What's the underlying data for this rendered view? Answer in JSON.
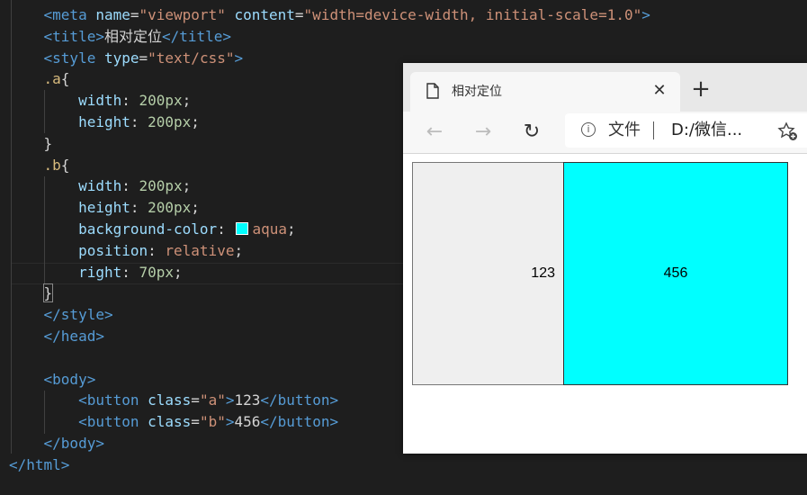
{
  "editor": {
    "lines": [
      {
        "indent": "    ",
        "tokens": [
          [
            "tag",
            "<meta "
          ],
          [
            "attr",
            "name"
          ],
          [
            "txt",
            "="
          ],
          [
            "str",
            "\"viewport\""
          ],
          [
            "txt",
            " "
          ],
          [
            "attr",
            "content"
          ],
          [
            "txt",
            "="
          ],
          [
            "str",
            "\"width=device-width, initial-scale=1.0\""
          ],
          [
            "tag",
            ">"
          ]
        ]
      },
      {
        "indent": "    ",
        "tokens": [
          [
            "tag",
            "<title>"
          ],
          [
            "txt",
            "相对定位"
          ],
          [
            "tag",
            "</title>"
          ]
        ]
      },
      {
        "indent": "    ",
        "tokens": [
          [
            "tag",
            "<style "
          ],
          [
            "attr",
            "type"
          ],
          [
            "txt",
            "="
          ],
          [
            "str",
            "\"text/css\""
          ],
          [
            "tag",
            ">"
          ]
        ]
      },
      {
        "indent": "    ",
        "tokens": [
          [
            "sel",
            ".a"
          ],
          [
            "brace",
            "{"
          ]
        ]
      },
      {
        "indent": "        ",
        "tokens": [
          [
            "prop",
            "width"
          ],
          [
            "txt",
            ": "
          ],
          [
            "num",
            "200px"
          ],
          [
            "txt",
            ";"
          ]
        ]
      },
      {
        "indent": "        ",
        "tokens": [
          [
            "prop",
            "height"
          ],
          [
            "txt",
            ": "
          ],
          [
            "num",
            "200px"
          ],
          [
            "txt",
            ";"
          ]
        ]
      },
      {
        "indent": "    ",
        "tokens": [
          [
            "brace",
            "}"
          ]
        ]
      },
      {
        "indent": "    ",
        "tokens": [
          [
            "sel",
            ".b"
          ],
          [
            "brace",
            "{"
          ]
        ]
      },
      {
        "indent": "        ",
        "tokens": [
          [
            "prop",
            "width"
          ],
          [
            "txt",
            ": "
          ],
          [
            "num",
            "200px"
          ],
          [
            "txt",
            ";"
          ]
        ]
      },
      {
        "indent": "        ",
        "tokens": [
          [
            "prop",
            "height"
          ],
          [
            "txt",
            ": "
          ],
          [
            "num",
            "200px"
          ],
          [
            "txt",
            ";"
          ]
        ]
      },
      {
        "indent": "        ",
        "tokens": [
          [
            "prop",
            "background-color"
          ],
          [
            "txt",
            ": "
          ],
          [
            "swatch",
            "aqua"
          ],
          [
            "val",
            "aqua"
          ],
          [
            "txt",
            ";"
          ]
        ]
      },
      {
        "indent": "        ",
        "tokens": [
          [
            "prop",
            "position"
          ],
          [
            "txt",
            ": "
          ],
          [
            "val",
            "relative"
          ],
          [
            "txt",
            ";"
          ]
        ]
      },
      {
        "indent": "        ",
        "tokens": [
          [
            "prop",
            "right"
          ],
          [
            "txt",
            ": "
          ],
          [
            "num",
            "70px"
          ],
          [
            "txt",
            ";"
          ]
        ]
      },
      {
        "indent": "    ",
        "tokens": [
          [
            "brace",
            "}"
          ]
        ]
      },
      {
        "indent": "    ",
        "tokens": [
          [
            "tag",
            "</style>"
          ]
        ]
      },
      {
        "indent": "    ",
        "tokens": [
          [
            "tag",
            "</head>"
          ]
        ]
      },
      {
        "indent": "",
        "tokens": []
      },
      {
        "indent": "    ",
        "tokens": [
          [
            "tag",
            "<body>"
          ]
        ]
      },
      {
        "indent": "        ",
        "tokens": [
          [
            "tag",
            "<button "
          ],
          [
            "attr",
            "class"
          ],
          [
            "txt",
            "="
          ],
          [
            "str",
            "\"a\""
          ],
          [
            "tag",
            ">"
          ],
          [
            "txt",
            "123"
          ],
          [
            "tag",
            "</button>"
          ]
        ]
      },
      {
        "indent": "        ",
        "tokens": [
          [
            "tag",
            "<button "
          ],
          [
            "attr",
            "class"
          ],
          [
            "txt",
            "="
          ],
          [
            "str",
            "\"b\""
          ],
          [
            "tag",
            ">"
          ],
          [
            "txt",
            "456"
          ],
          [
            "tag",
            "</button>"
          ]
        ]
      },
      {
        "indent": "    ",
        "tokens": [
          [
            "tag",
            "</body>"
          ]
        ]
      },
      {
        "indent": "",
        "tokens": [
          [
            "tag",
            "</html>"
          ]
        ]
      }
    ],
    "swatch_color": "#00ffff"
  },
  "browser": {
    "tab_title": "相对定位",
    "tab_icon": "page-icon",
    "close_glyph": "✕",
    "newtab_glyph": "+",
    "back_glyph": "←",
    "forward_glyph": "→",
    "reload_glyph": "↻",
    "info_glyph": "i",
    "address_label": "文件",
    "address_url": "D:/微信...",
    "favorites_icon": "star-add-icon"
  },
  "page": {
    "button_a_label": "123",
    "button_b_label": "456",
    "button_b_color": "#00ffff"
  }
}
